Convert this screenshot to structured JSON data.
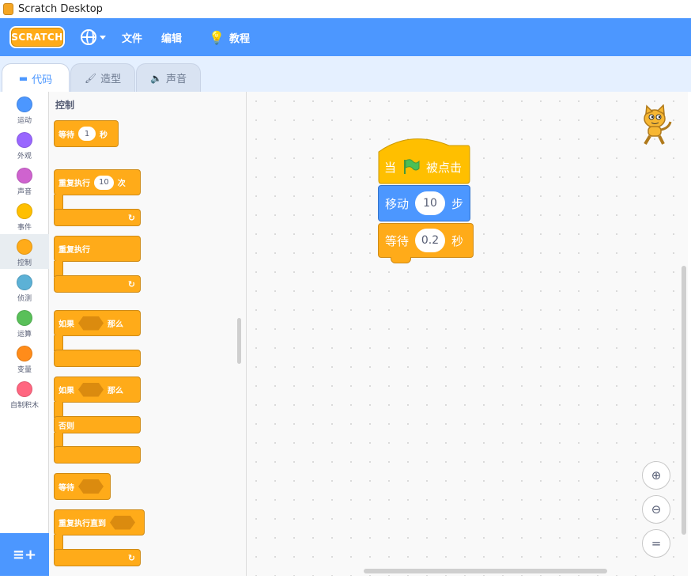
{
  "window": {
    "title": "Scratch Desktop"
  },
  "menubar": {
    "logo": "SCRATCH",
    "file": "文件",
    "edit": "编辑",
    "tutorials": "教程"
  },
  "tabs": [
    {
      "label": "代码"
    },
    {
      "label": "造型"
    },
    {
      "label": "声音"
    }
  ],
  "categories": [
    {
      "label": "运动",
      "color": "#4c97ff"
    },
    {
      "label": "外观",
      "color": "#9966ff"
    },
    {
      "label": "声音",
      "color": "#cf63cf"
    },
    {
      "label": "事件",
      "color": "#ffbf00"
    },
    {
      "label": "控制",
      "color": "#ffab19"
    },
    {
      "label": "侦测",
      "color": "#5cb1d6"
    },
    {
      "label": "运算",
      "color": "#59c059"
    },
    {
      "label": "变量",
      "color": "#ff8c1a"
    },
    {
      "label": "自制积木",
      "color": "#ff6680"
    }
  ],
  "palette": {
    "title": "控制",
    "wait": {
      "pre": "等待",
      "value": "1",
      "post": "秒"
    },
    "repeat": {
      "pre": "重复执行",
      "value": "10",
      "post": "次"
    },
    "forever": "重复执行",
    "if_then": {
      "pre": "如果",
      "post": "那么"
    },
    "if_else": {
      "pre": "如果",
      "post": "那么",
      "else": "否则"
    },
    "wait_until": "等待",
    "repeat_until": "重复执行直到"
  },
  "script": {
    "hat": {
      "pre": "当",
      "post": "被点击"
    },
    "move": {
      "pre": "移动",
      "value": "10",
      "post": "步"
    },
    "wait": {
      "pre": "等待",
      "value": "0.2",
      "post": "秒"
    }
  },
  "zoom": {
    "in": "+",
    "out": "−",
    "reset": "="
  }
}
